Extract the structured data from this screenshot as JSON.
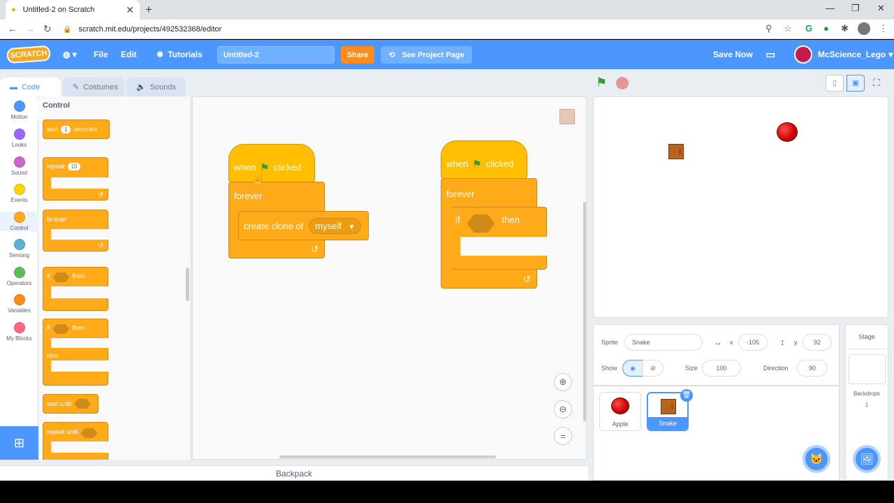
{
  "browser": {
    "tab_title": "Untitled-2 on Scratch",
    "url": "scratch.mit.edu/projects/492532368/editor"
  },
  "menubar": {
    "logo": "SCRATCH",
    "file": "File",
    "edit": "Edit",
    "tutorials": "Tutorials",
    "project_title": "Untitled-2",
    "share": "Share",
    "see_project": "See Project Page",
    "save_now": "Save Now",
    "username": "McScience_Lego"
  },
  "tabs": {
    "code": "Code",
    "costumes": "Costumes",
    "sounds": "Sounds"
  },
  "categories": [
    {
      "label": "Motion",
      "color": "#4c97ff"
    },
    {
      "label": "Looks",
      "color": "#9966ff"
    },
    {
      "label": "Sound",
      "color": "#cf63cf"
    },
    {
      "label": "Events",
      "color": "#ffd500"
    },
    {
      "label": "Control",
      "color": "#ffab19"
    },
    {
      "label": "Sensing",
      "color": "#5cb1d6"
    },
    {
      "label": "Operators",
      "color": "#59c059"
    },
    {
      "label": "Variables",
      "color": "#ff8c1a"
    },
    {
      "label": "My Blocks",
      "color": "#ff6680"
    }
  ],
  "palette": {
    "heading": "Control",
    "wait": "wait",
    "wait_value": "1",
    "seconds": "seconds",
    "repeat": "repeat",
    "repeat_value": "10",
    "forever": "forever",
    "if": "if",
    "then": "then",
    "if2": "if",
    "then2": "then",
    "else": "else",
    "wait_until": "wait until",
    "repeat_until": "repeat until"
  },
  "script1": {
    "when": "when",
    "clicked": "clicked",
    "forever": "forever",
    "create_clone": "create clone of",
    "target": "myself"
  },
  "script2": {
    "when": "when",
    "clicked": "clicked",
    "forever": "forever",
    "if": "if",
    "then": "then"
  },
  "backpack": "Backpack",
  "sprite_info": {
    "sprite_label": "Sprite",
    "sprite_name": "Snake",
    "x_label": "x",
    "x_value": "-105",
    "y_label": "y",
    "y_value": "92",
    "show_label": "Show",
    "size_label": "Size",
    "size_value": "100",
    "direction_label": "Direction",
    "direction_value": "90"
  },
  "sprites": [
    {
      "name": "Apple"
    },
    {
      "name": "Snake"
    }
  ],
  "stage_panel": {
    "title": "Stage",
    "backdrops_label": "Backdrops",
    "backdrops_count": "1"
  }
}
